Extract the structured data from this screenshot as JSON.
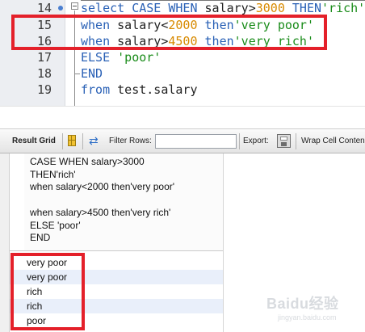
{
  "editor": {
    "lines": [
      {
        "number": "14",
        "tokens": [
          [
            "kw",
            "select "
          ],
          [
            "kw",
            "CASE "
          ],
          [
            "kw",
            "WHEN "
          ],
          [
            "id",
            "salary>"
          ],
          [
            "num",
            "3000"
          ],
          [
            "kw",
            " THEN"
          ],
          [
            "str",
            "'rich'"
          ]
        ]
      },
      {
        "number": "15",
        "tokens": [
          [
            "kw",
            "when "
          ],
          [
            "id",
            "salary<"
          ],
          [
            "num",
            "2000"
          ],
          [
            "kw",
            " then"
          ],
          [
            "str",
            "'very poor'"
          ]
        ]
      },
      {
        "number": "16",
        "tokens": [
          [
            "kw",
            "when "
          ],
          [
            "id",
            "salary>"
          ],
          [
            "num",
            "4500"
          ],
          [
            "kw",
            " then"
          ],
          [
            "str",
            "'very rich'"
          ]
        ]
      },
      {
        "number": "17",
        "tokens": [
          [
            "kw",
            "ELSE "
          ],
          [
            "str",
            "'poor'"
          ]
        ]
      },
      {
        "number": "18",
        "tokens": [
          [
            "kw",
            "END"
          ]
        ]
      },
      {
        "number": "19",
        "tokens": [
          [
            "kw",
            "from "
          ],
          [
            "id",
            "test.salary"
          ]
        ]
      }
    ]
  },
  "toolbar": {
    "result_grid": "Result Grid",
    "filter_rows": "Filter Rows:",
    "export": "Export:",
    "wrap": "Wrap Cell Conten"
  },
  "grid": {
    "column_header": "CASE WHEN salary>3000\nTHEN'rich'\nwhen salary<2000 then'very poor'\n\nwhen salary>4500 then'very rich'\nELSE 'poor'\nEND",
    "rows": [
      "very poor",
      "very poor",
      "rich",
      "rich",
      "poor"
    ]
  },
  "watermark": {
    "brand": "Baidu经验",
    "url": "jingyan.baidu.com"
  },
  "colors": {
    "keyword": "#2a61b6",
    "number": "#d88a00",
    "string": "#1a8c1a",
    "highlight": "#e4202a"
  }
}
